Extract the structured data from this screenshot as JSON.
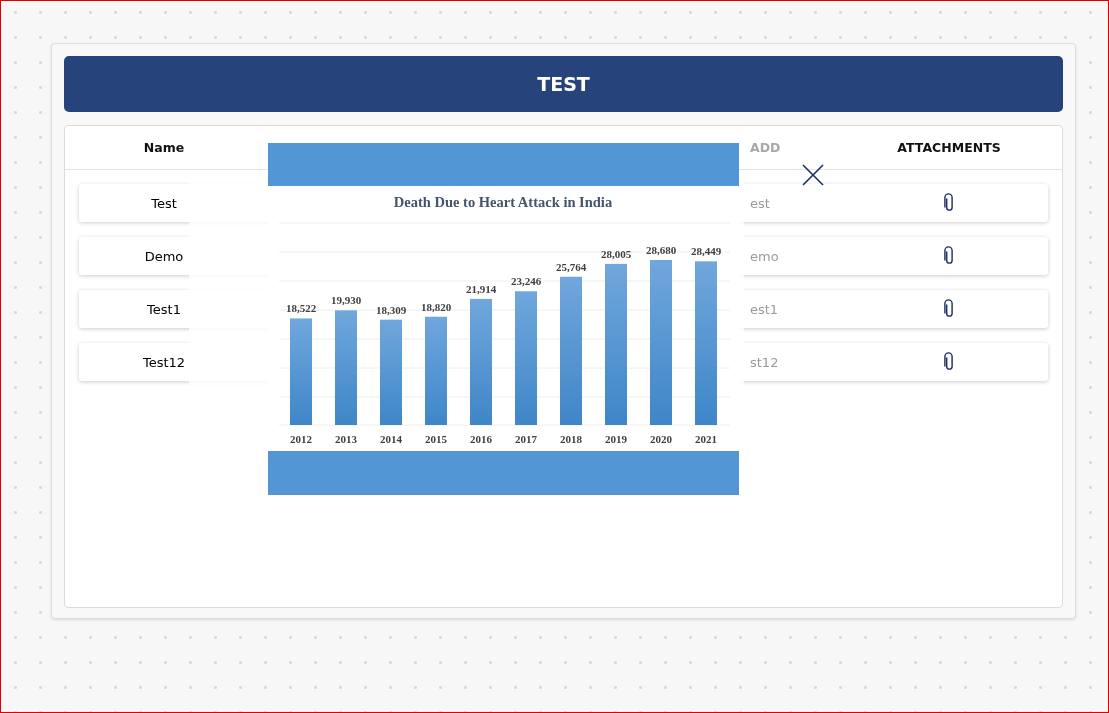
{
  "title": "TEST",
  "table": {
    "columns": [
      {
        "label": "Name",
        "dimmed": false
      },
      {
        "label": "ADD",
        "dimmed": true
      },
      {
        "label": "ATTACHMENTS",
        "dimmed": false
      }
    ],
    "rows": [
      {
        "name": "Test",
        "add": "est"
      },
      {
        "name": "Demo",
        "add": "emo"
      },
      {
        "name": "Test1",
        "add": "est1"
      },
      {
        "name": "Test12",
        "add": "st12"
      }
    ]
  },
  "modal": {
    "chart_data": {
      "type": "bar",
      "title": "Death Due to Heart Attack in India",
      "categories": [
        "2012",
        "2013",
        "2014",
        "2015",
        "2016",
        "2017",
        "2018",
        "2019",
        "2020",
        "2021"
      ],
      "values": [
        18522,
        19930,
        18309,
        18820,
        21914,
        23246,
        25764,
        28005,
        28680,
        28449
      ],
      "value_labels": [
        "18,522",
        "19,930",
        "18,309",
        "18,820",
        "21,914",
        "23,246",
        "25,764",
        "28,005",
        "28,680",
        "28,449"
      ],
      "data_labels": true
    }
  }
}
